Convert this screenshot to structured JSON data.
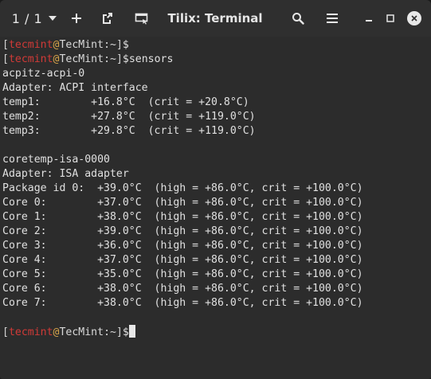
{
  "titlebar": {
    "session_count": "1 / 1",
    "title": "Tilix: Terminal",
    "icons": {
      "session_menu": "chevron-down-icon",
      "add": "plus-icon",
      "detach": "detach-icon",
      "sync_input": "sync-input-icon",
      "search": "search-icon",
      "menu": "hamburger-menu-icon",
      "minimize": "minimize-icon",
      "maximize": "maximize-icon",
      "close": "close-icon"
    }
  },
  "colors": {
    "titlebar_bg": "#2f2f2f",
    "terminal_bg": "#2c2c2c",
    "prompt_user": "#d13a37",
    "prompt_at": "#d8a54a",
    "text": "#e0e0e0"
  },
  "prompt": {
    "open_bracket": "[",
    "user": "tecmint",
    "at": "@",
    "host": "TecMint",
    "path": ":~",
    "close_bracket": "]",
    "dollar": "$"
  },
  "terminal": {
    "command": "sensors",
    "output": [
      "acpitz-acpi-0",
      "Adapter: ACPI interface",
      "temp1:        +16.8°C  (crit = +20.8°C)",
      "temp2:        +27.8°C  (crit = +119.0°C)",
      "temp3:        +29.8°C  (crit = +119.0°C)",
      "",
      "coretemp-isa-0000",
      "Adapter: ISA adapter",
      "Package id 0:  +39.0°C  (high = +86.0°C, crit = +100.0°C)",
      "Core 0:        +37.0°C  (high = +86.0°C, crit = +100.0°C)",
      "Core 1:        +38.0°C  (high = +86.0°C, crit = +100.0°C)",
      "Core 2:        +39.0°C  (high = +86.0°C, crit = +100.0°C)",
      "Core 3:        +36.0°C  (high = +86.0°C, crit = +100.0°C)",
      "Core 4:        +37.0°C  (high = +86.0°C, crit = +100.0°C)",
      "Core 5:        +35.0°C  (high = +86.0°C, crit = +100.0°C)",
      "Core 6:        +38.0°C  (high = +86.0°C, crit = +100.0°C)",
      "Core 7:        +38.0°C  (high = +86.0°C, crit = +100.0°C)",
      ""
    ]
  }
}
